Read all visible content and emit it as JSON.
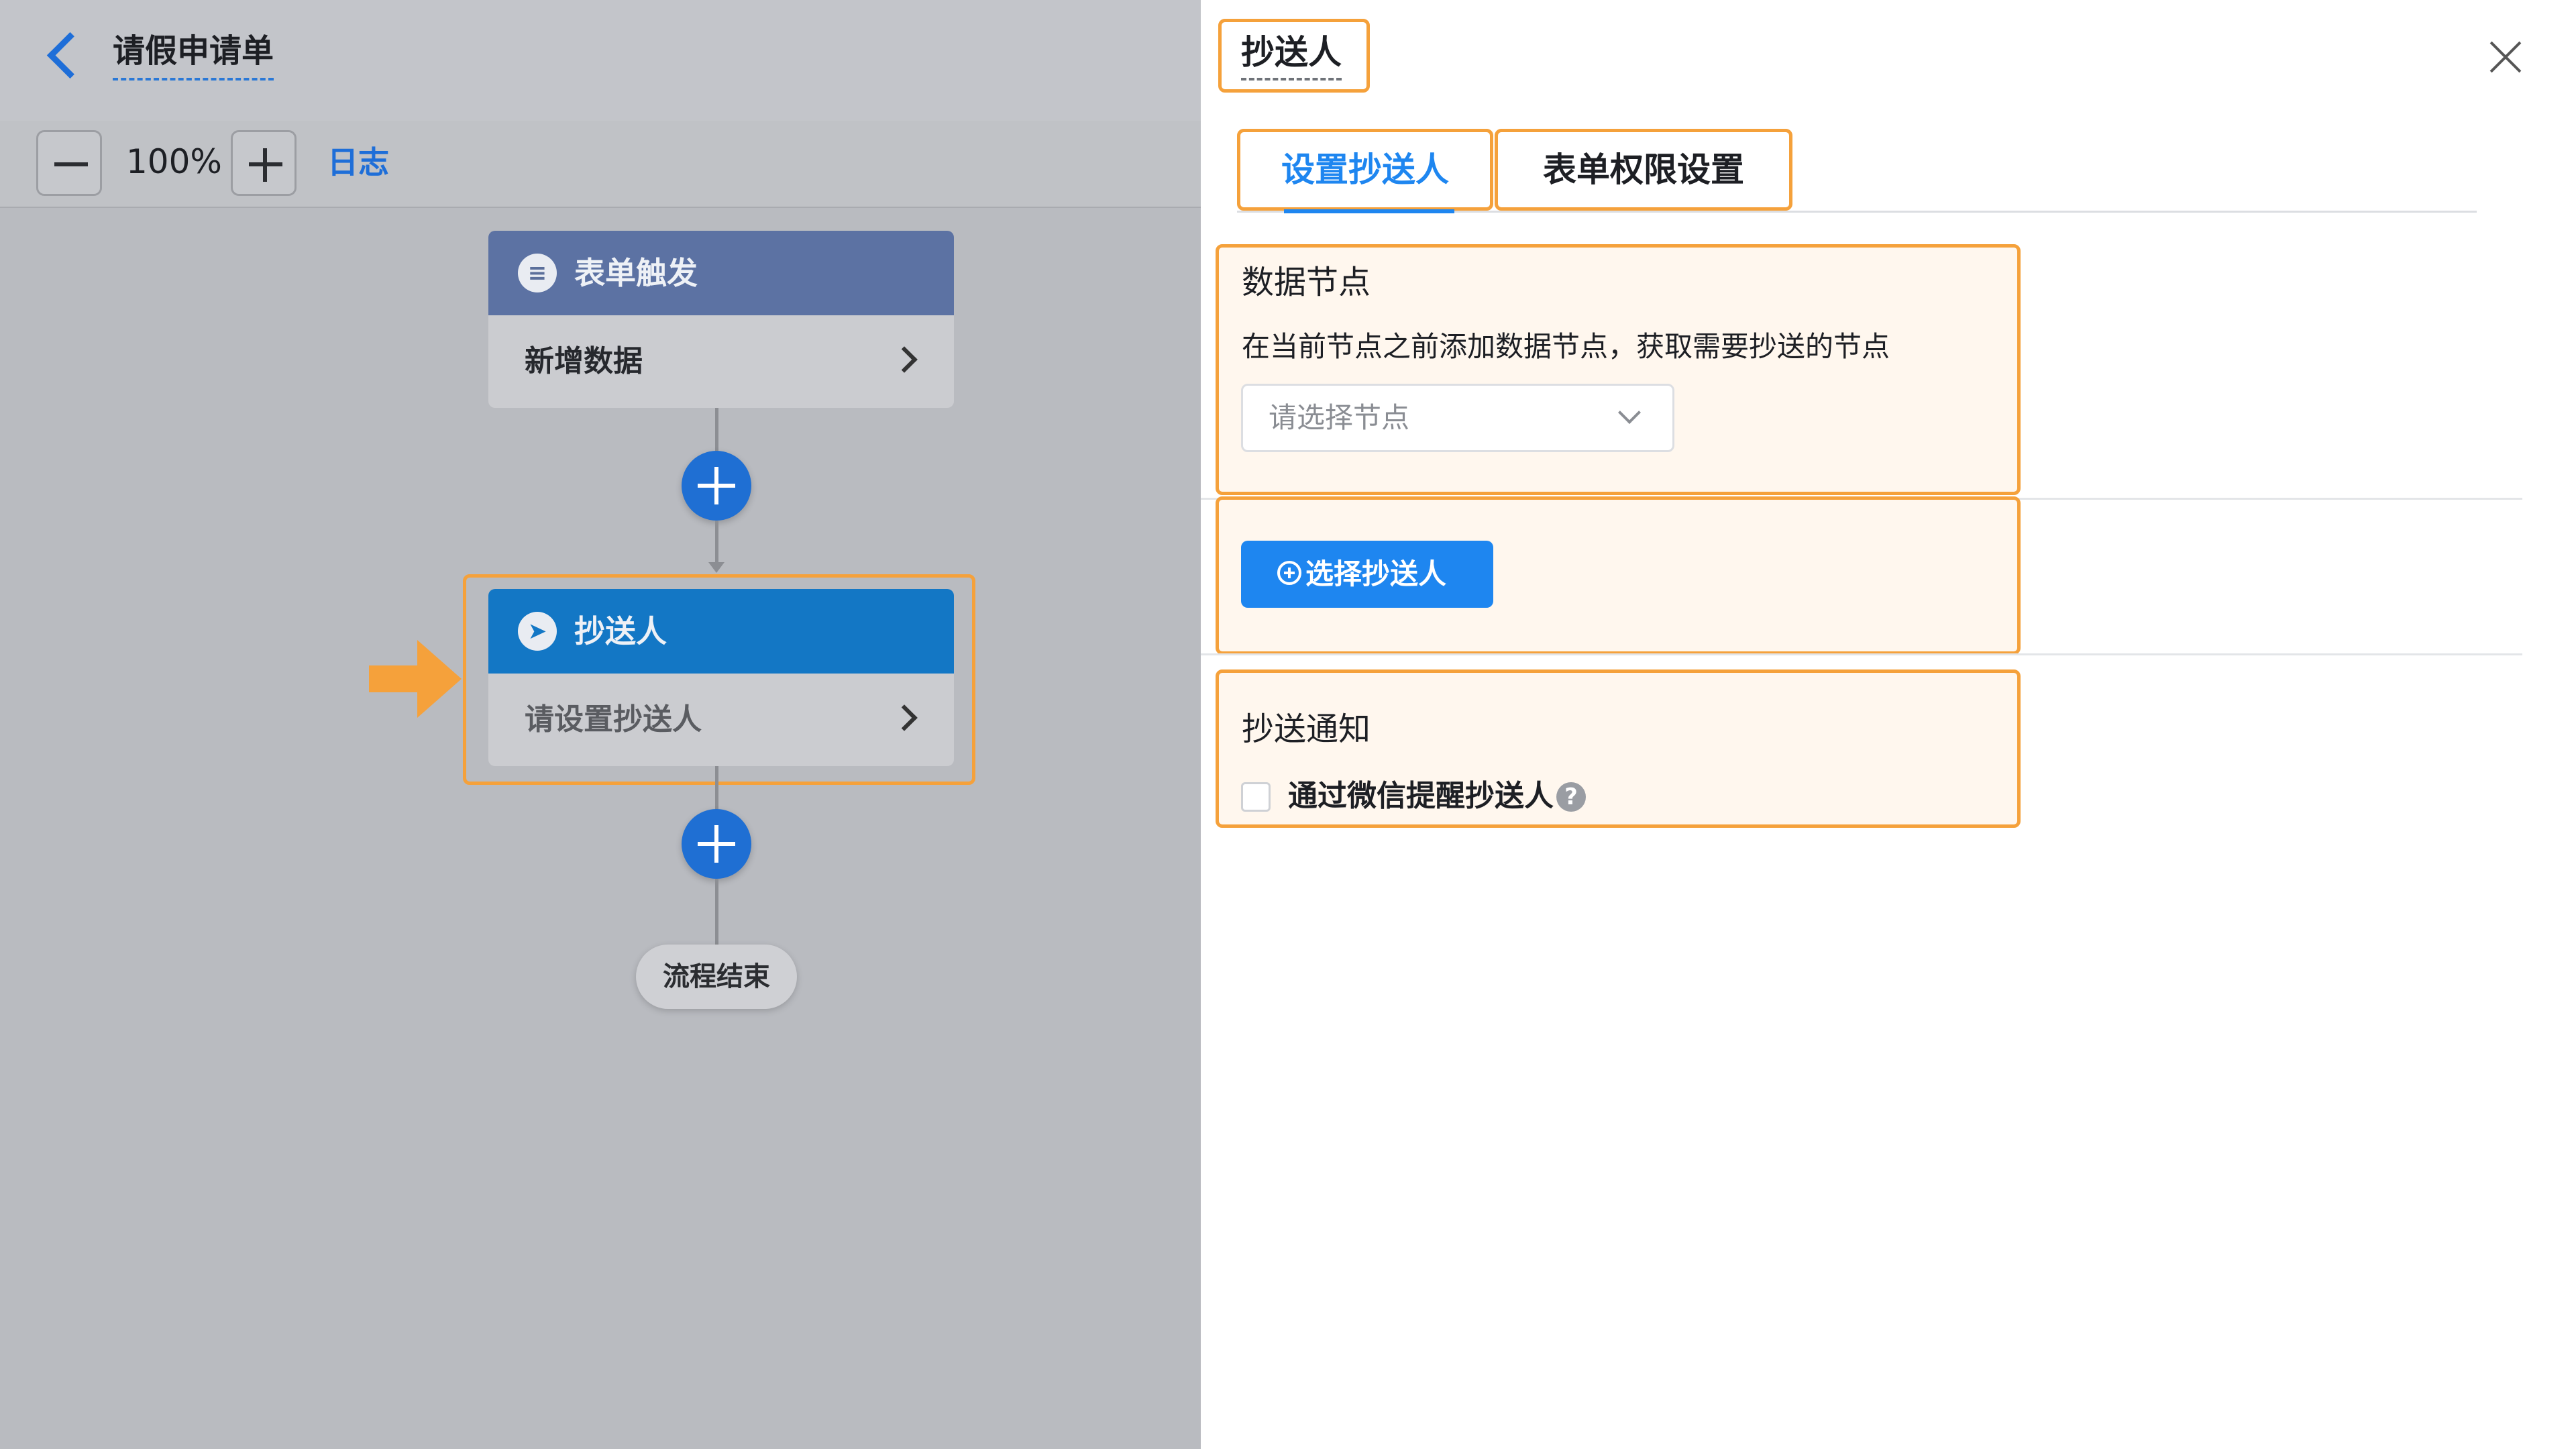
{
  "header": {
    "title": "请假申请单"
  },
  "toolbar": {
    "zoom_level": "100%",
    "log_link": "日志"
  },
  "flow": {
    "trigger_node": {
      "title": "表单触发",
      "body": "新增数据",
      "header_color": "#5c72a3"
    },
    "cc_node": {
      "title": "抄送人",
      "body": "请设置抄送人",
      "header_color": "#1377c5"
    },
    "end_label": "流程结束"
  },
  "panel": {
    "title": "抄送人",
    "tabs": [
      {
        "label": "设置抄送人",
        "active": true
      },
      {
        "label": "表单权限设置",
        "active": false
      }
    ],
    "data_node": {
      "title": "数据节点",
      "description": "在当前节点之前添加数据节点，获取需要抄送的节点",
      "select_placeholder": "请选择节点"
    },
    "select_cc_button": "选择抄送人",
    "notify": {
      "title": "抄送通知",
      "checkbox_label": "通过微信提醒抄送人",
      "checked": false
    }
  },
  "colors": {
    "accent_blue": "#1e86f0",
    "highlight_orange": "#f5a13b"
  }
}
